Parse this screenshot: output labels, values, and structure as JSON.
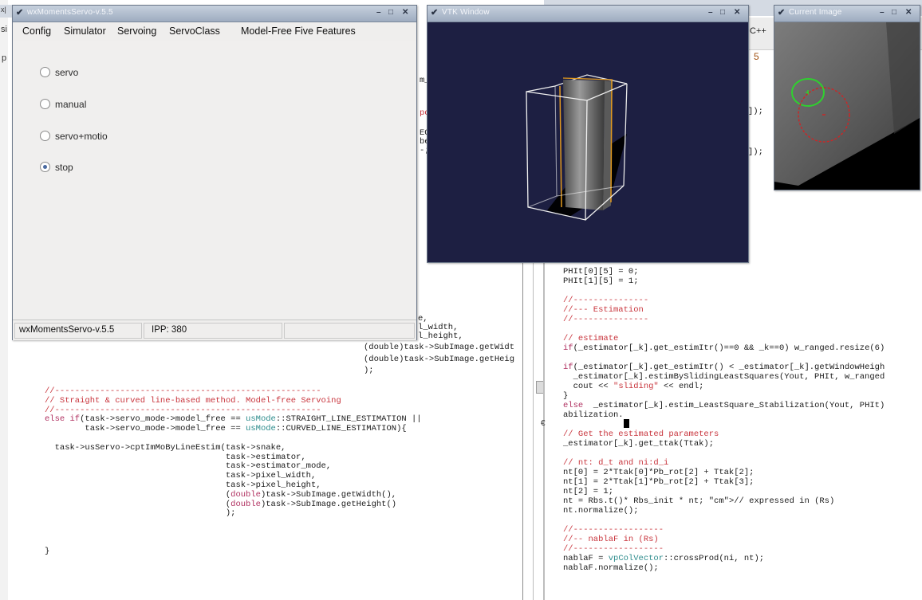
{
  "moments_window": {
    "title": "wxMomentsServo-v.5.5",
    "menu": [
      "Config",
      "Simulator",
      "Servoing",
      "ServoClass",
      "Model-Free Five Features"
    ],
    "radios": [
      {
        "label": "servo",
        "selected": false
      },
      {
        "label": "manual",
        "selected": false
      },
      {
        "label": "servo+motio",
        "selected": false
      },
      {
        "label": "stop",
        "selected": true
      }
    ],
    "status": {
      "app": "wxMomentsServo-v.5.5",
      "ipp": "IPP: 380"
    }
  },
  "vtk_window": {
    "title": "VTK Window"
  },
  "image_window": {
    "title": "Current Image"
  },
  "window_buttons": {
    "minimize": "–",
    "maximize": "□",
    "close": "✕"
  },
  "behind": {
    "left_edge_chars": [
      "x|",
      "si",
      "p"
    ],
    "cpp_tab": "C++"
  },
  "code_left_top": [
    "m_",
    "poc",
    "EO",
    "bet",
    "-;",
    "e,",
    "l_width,",
    "l_height,",
    "(double)task->SubImage.getWidt",
    "(double)task->SubImage.getHeig",
    ");"
  ],
  "code_left": [
    "//-----------------------------------------------------",
    "// Straight & curved line-based method. Model-free Servoing",
    "//-----------------------------------------------------",
    "else if(task->servo_mode->model_free == usMode::STRAIGHT_LINE_ESTIMATION ||",
    "        task->servo_mode->model_free == usMode::CURVED_LINE_ESTIMATION){",
    "",
    "  task->usServo->cptImMoByLineEstim(task->snake,",
    "                                    task->estimator,",
    "                                    task->estimator_mode,",
    "                                    task->pixel_width,",
    "                                    task->pixel_height,",
    "                                    (double)task->SubImage.getWidth(),",
    "                                    (double)task->SubImage.getHeight()",
    "                                    );",
    "",
    "",
    "",
    "}"
  ],
  "code_right_top": [
    "]);",
    "]);"
  ],
  "code_right": [
    "PHIt[0][5] = 0;",
    "PHIt[1][5] = 1;",
    "",
    "//---------------",
    "//--- Estimation",
    "//---------------",
    "",
    "// estimate",
    "if(_estimator[_k].get_estimItr()==0 && _k==0) w_ranged.resize(6)",
    "",
    "if(_estimator[_k].get_estimItr() < _estimator[_k].getWindowHeigh",
    "  _estimator[_k].estimBySlidingLeastSquares(Yout, PHIt, w_ranged",
    "  cout << \"sliding\" << endl;",
    "}",
    "else  _estimator[_k].estim_LeastSquare_Stabilization(Yout, PHIt)",
    "abilization.",
    "",
    "// Get the estimated parameters",
    "_estimator[_k].get_ttak(Ttak);",
    "",
    "// nt: d_t and ni:d_i",
    "nt[0] = 2*Ttak[0]*Pb_rot[2] + Ttak[2];",
    "nt[1] = 2*Ttak[1]*Pb_rot[2] + Ttak[3];",
    "nt[2] = 1;",
    "nt = Rbs.t()* Rbs_init * nt; // expressed in (Rs)",
    "nt.normalize();",
    "",
    "//------------------",
    "//-- nablaF in (Rs)",
    "//------------------",
    "nablaF = vpColVector::crossProd(ni, nt);",
    "nablaF.normalize();"
  ]
}
